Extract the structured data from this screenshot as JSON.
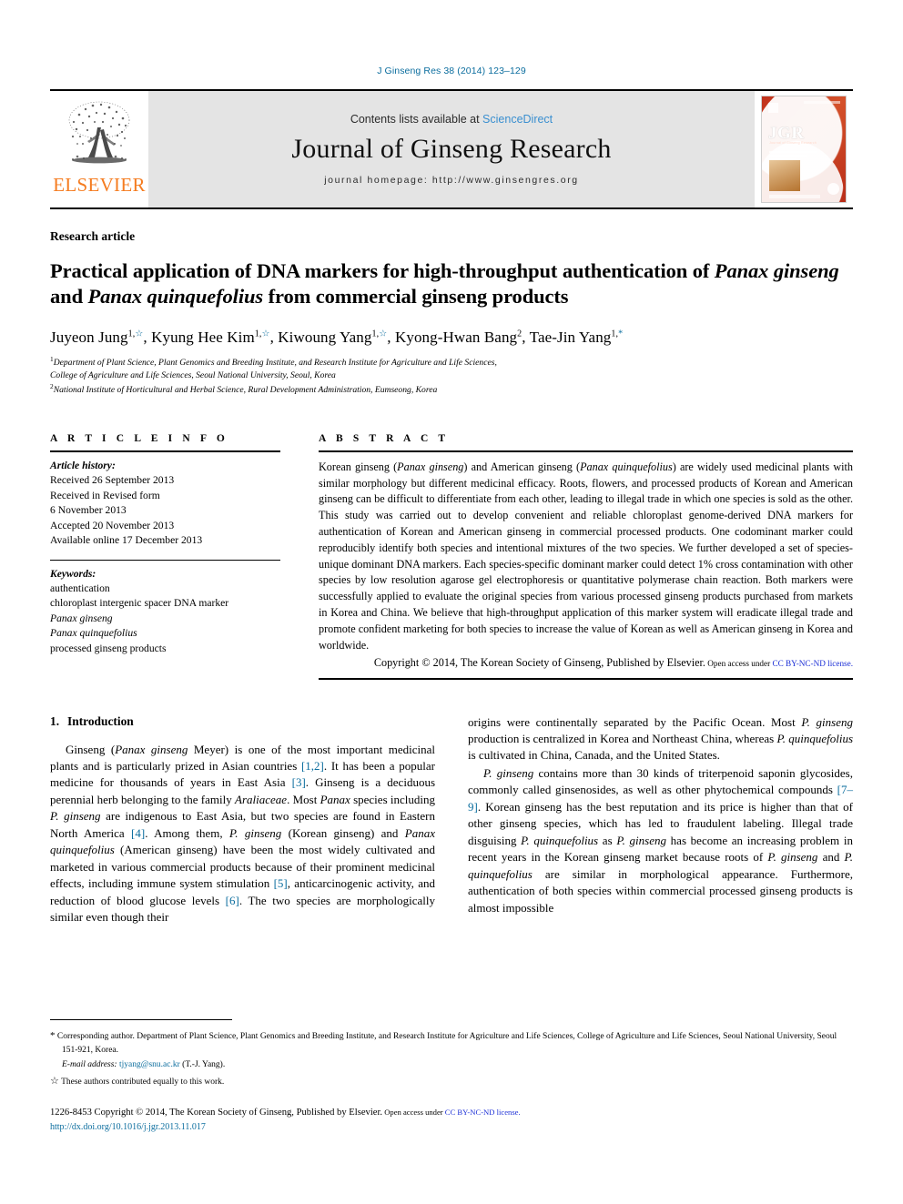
{
  "running_head": "J Ginseng Res 38 (2014) 123–129",
  "masthead": {
    "publisher_name": "ELSEVIER",
    "contents_prefix": "Contents lists available at ",
    "contents_link": "ScienceDirect",
    "journal_title": "Journal of Ginseng Research",
    "homepage_line": "journal homepage: http://www.ginsengres.org",
    "cover": {
      "acronym": "JGR",
      "subtitle": "Journal of Ginseng Research"
    }
  },
  "article": {
    "kind": "Research article",
    "title_parts": [
      {
        "text": "Practical application of DNA markers for high-throughput authentication of ",
        "italic": false
      },
      {
        "text": "Panax",
        "italic": true
      },
      {
        "text": " ",
        "italic": false
      },
      {
        "text": "ginseng",
        "italic": true
      },
      {
        "text": " and ",
        "italic": false
      },
      {
        "text": "Panax quinquefolius",
        "italic": true
      },
      {
        "text": " from commercial ginseng products",
        "italic": false
      }
    ],
    "authors": [
      {
        "name": "Juyeon Jung",
        "sup_num": "1,",
        "sup_mark": "☆"
      },
      {
        "name": "Kyung Hee Kim",
        "sup_num": "1,",
        "sup_mark": "☆"
      },
      {
        "name": "Kiwoung Yang",
        "sup_num": "1,",
        "sup_mark": "☆"
      },
      {
        "name": "Kyong-Hwan Bang",
        "sup_num": "2",
        "sup_mark": ""
      },
      {
        "name": "Tae-Jin Yang",
        "sup_num": "1,",
        "sup_mark": "*"
      }
    ],
    "affiliations": [
      {
        "sup": "1",
        "text": "Department of Plant Science, Plant Genomics and Breeding Institute, and Research Institute for Agriculture and Life Sciences,"
      },
      {
        "sup": "",
        "text": "College of Agriculture and Life Sciences, Seoul National University, Seoul, Korea"
      },
      {
        "sup": "2",
        "text": "National Institute of Horticultural and Herbal Science, Rural Development Administration, Eumseong, Korea"
      }
    ]
  },
  "article_info": {
    "heading": "A R T I C L E  I N F O",
    "history_label": "Article history:",
    "history": [
      "Received 26 September 2013",
      "Received in Revised form",
      "6 November 2013",
      "Accepted 20 November 2013",
      "Available online 17 December 2013"
    ],
    "keywords_label": "Keywords:",
    "keywords": [
      {
        "text": "authentication",
        "italic": false
      },
      {
        "text": "chloroplast intergenic spacer DNA marker",
        "italic": false
      },
      {
        "text": "Panax ginseng",
        "italic": true
      },
      {
        "text": "Panax quinquefolius",
        "italic": true
      },
      {
        "text": "processed ginseng products",
        "italic": false
      }
    ]
  },
  "abstract": {
    "heading": "A B S T R A C T",
    "paragraph_parts": [
      {
        "text": "Korean ginseng (",
        "italic": false
      },
      {
        "text": "Panax ginseng",
        "italic": true
      },
      {
        "text": ") and American ginseng (",
        "italic": false
      },
      {
        "text": "Panax quinquefolius",
        "italic": true
      },
      {
        "text": ") are widely used medicinal plants with similar morphology but different medicinal efficacy. Roots, flowers, and processed products of Korean and American ginseng can be difficult to differentiate from each other, leading to illegal trade in which one species is sold as the other. This study was carried out to develop convenient and reliable chloroplast genome-derived DNA markers for authentication of Korean and American ginseng in commercial processed products. One codominant marker could reproducibly identify both species and intentional mixtures of the two species. We further developed a set of species-unique dominant DNA markers. Each species-specific dominant marker could detect 1% cross contamination with other species by low resolution agarose gel electrophoresis or quantitative polymerase chain reaction. Both markers were successfully applied to evaluate the original species from various processed ginseng products purchased from markets in Korea and China. We believe that high-throughput application of this marker system will eradicate illegal trade and promote confident marketing for both species to increase the value of Korean as well as American ginseng in Korea and worldwide.",
        "italic": false
      }
    ],
    "copyright_main": "Copyright © 2014, The Korean Society of Ginseng, Published by Elsevier.",
    "copyright_open": " Open access under ",
    "copyright_link": "CC BY-NC-ND license."
  },
  "body": {
    "section_number": "1.",
    "section_title": "Introduction",
    "left_paragraphs": [
      {
        "indent": true,
        "parts": [
          {
            "text": "Ginseng (",
            "style": "normal"
          },
          {
            "text": "Panax ginseng",
            "style": "italic"
          },
          {
            "text": " Meyer) is one of the most important medicinal plants and is particularly prized in Asian countries ",
            "style": "normal"
          },
          {
            "text": "[1,2]",
            "style": "cite"
          },
          {
            "text": ". It has been a popular medicine for thousands of years in East Asia ",
            "style": "normal"
          },
          {
            "text": "[3]",
            "style": "cite"
          },
          {
            "text": ". Ginseng is a deciduous perennial herb belonging to the family ",
            "style": "normal"
          },
          {
            "text": "Araliaceae",
            "style": "italic"
          },
          {
            "text": ". Most ",
            "style": "normal"
          },
          {
            "text": "Panax",
            "style": "italic"
          },
          {
            "text": " species including ",
            "style": "normal"
          },
          {
            "text": "P. ginseng",
            "style": "italic"
          },
          {
            "text": " are indigenous to East Asia, but two species are found in Eastern North America ",
            "style": "normal"
          },
          {
            "text": "[4]",
            "style": "cite"
          },
          {
            "text": ". Among them, ",
            "style": "normal"
          },
          {
            "text": "P. ginseng",
            "style": "italic"
          },
          {
            "text": " (Korean ginseng) and ",
            "style": "normal"
          },
          {
            "text": "Panax quinquefolius",
            "style": "italic"
          },
          {
            "text": " (American ginseng) have been the most widely cultivated and marketed in various commercial products because of their prominent medicinal effects, including immune system stimulation ",
            "style": "normal"
          },
          {
            "text": "[5]",
            "style": "cite"
          },
          {
            "text": ", anticarcinogenic activity, and reduction of blood glucose levels ",
            "style": "normal"
          },
          {
            "text": "[6]",
            "style": "cite"
          },
          {
            "text": ". The two species are morphologically similar even though their",
            "style": "normal"
          }
        ]
      }
    ],
    "right_paragraphs": [
      {
        "indent": false,
        "parts": [
          {
            "text": "origins were continentally separated by the Pacific Ocean. Most ",
            "style": "normal"
          },
          {
            "text": "P. ginseng",
            "style": "italic"
          },
          {
            "text": " production is centralized in Korea and Northeast China, whereas ",
            "style": "normal"
          },
          {
            "text": "P. quinquefolius",
            "style": "italic"
          },
          {
            "text": " is cultivated in China, Canada, and the United States.",
            "style": "normal"
          }
        ]
      },
      {
        "indent": true,
        "parts": [
          {
            "text": "P. ginseng",
            "style": "italic"
          },
          {
            "text": " contains more than 30 kinds of triterpenoid saponin glycosides, commonly called ginsenosides, as well as other phytochemical compounds ",
            "style": "normal"
          },
          {
            "text": "[7–9]",
            "style": "cite"
          },
          {
            "text": ". Korean ginseng has the best reputation and its price is higher than that of other ginseng species, which has led to fraudulent labeling. Illegal trade disguising ",
            "style": "normal"
          },
          {
            "text": "P. quinquefolius",
            "style": "italic"
          },
          {
            "text": " as ",
            "style": "normal"
          },
          {
            "text": "P. ginseng",
            "style": "italic"
          },
          {
            "text": " has become an increasing problem in recent years in the Korean ginseng market because roots of ",
            "style": "normal"
          },
          {
            "text": "P. ginseng",
            "style": "italic"
          },
          {
            "text": " and ",
            "style": "normal"
          },
          {
            "text": "P. quinquefolius",
            "style": "italic"
          },
          {
            "text": " are similar in morphological appearance. Furthermore, authentication of both species within commercial processed ginseng products is almost impossible",
            "style": "normal"
          }
        ]
      }
    ]
  },
  "footnotes": {
    "corresponding_star": "*",
    "corresponding": "Corresponding author. Department of Plant Science, Plant Genomics and Breeding Institute, and Research Institute for Agriculture and Life Sciences, College of Agriculture and Life Sciences, Seoul National University, Seoul 151-921, Korea.",
    "email_label": "E-mail address:",
    "email": "tjyang@snu.ac.kr",
    "email_suffix": "(T.-J. Yang).",
    "equal_star": "☆",
    "equal_note": "These authors contributed equally to this work."
  },
  "footer": {
    "issn_copyright": "1226-8453 Copyright © 2014, The Korean Society of Ginseng, Published by Elsevier.",
    "open_access": " Open access under ",
    "license_link": "CC BY-NC-ND license.",
    "doi": "http://dx.doi.org/10.1016/j.jgr.2013.11.017"
  },
  "colors": {
    "link_teal": "#0b6d9e",
    "link_blue": "#1c2fd6",
    "sciencedirect_blue": "#3a8fd0",
    "elsevier_orange": "#f57c20"
  }
}
